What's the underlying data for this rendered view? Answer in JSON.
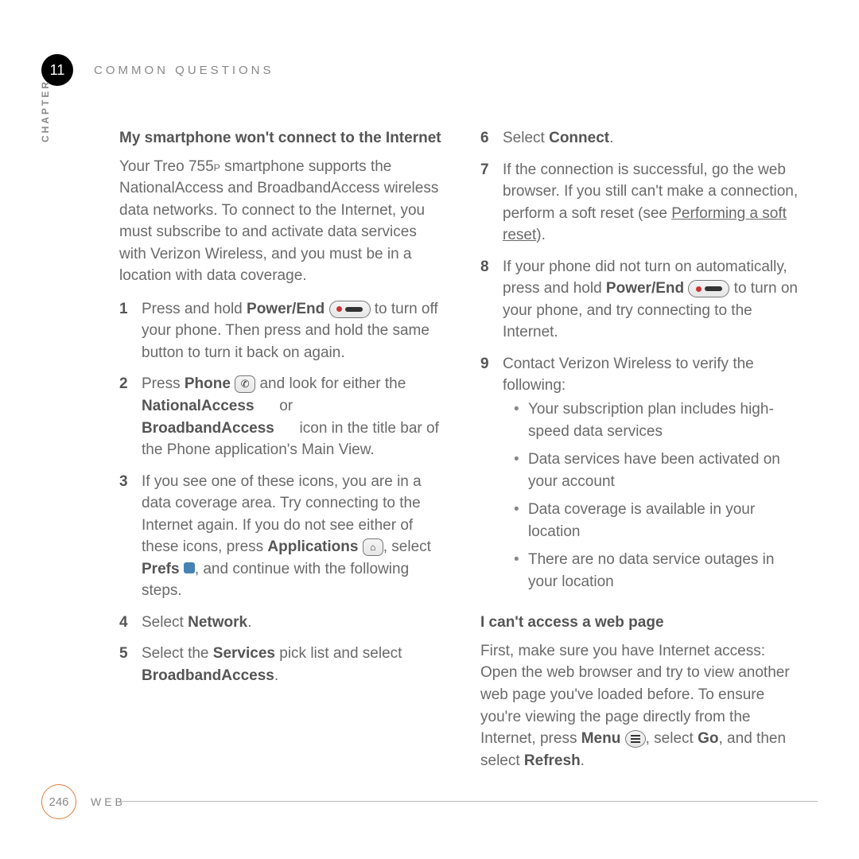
{
  "header": {
    "chapter_number": "11",
    "title": "COMMON QUESTIONS",
    "vertical_label": "CHAPTER"
  },
  "left": {
    "heading": "My smartphone won't connect to the Internet",
    "intro_a": "Your Treo 755",
    "intro_sub": "P",
    "intro_b": " smartphone supports the NationalAccess and BroadbandAccess wireless data networks. To connect to the Internet, you must subscribe to and activate data services with Verizon Wireless, and you must be in a location with data coverage.",
    "step1_a": "Press and hold ",
    "step1_bold1": "Power/End",
    "step1_b": " to turn off your phone. Then press and hold the same button to turn it back on again.",
    "step2_a": "Press ",
    "step2_bold1": "Phone",
    "step2_b": " and look for either the ",
    "step2_bold2": "NationalAccess",
    "step2_c": " or ",
    "step2_bold3": "BroadbandAccess",
    "step2_d": " icon in the title bar of the Phone application's Main View.",
    "step3_a": "If you see one of these icons, you are in a data coverage area. Try connecting to the Internet again. If you do not see either of these icons, press ",
    "step3_bold1": "Applications",
    "step3_b": ", select ",
    "step3_bold2": "Prefs",
    "step3_c": ", and continue with the following steps.",
    "step4_a": "Select ",
    "step4_bold1": "Network",
    "step4_b": ".",
    "step5_a": "Select the ",
    "step5_bold1": "Services",
    "step5_b": " pick list and select ",
    "step5_bold2": "BroadbandAccess",
    "step5_c": "."
  },
  "right": {
    "step6_a": "Select ",
    "step6_bold1": "Connect",
    "step6_b": ".",
    "step7_a": "If the connection is successful, go the web browser. If you still can't make a connection, perform a soft reset (see ",
    "step7_link": "Performing a soft reset",
    "step7_b": ").",
    "step8_a": "If your phone did not turn on automatically, press and hold ",
    "step8_bold1": "Power/End",
    "step8_b": " to turn on your phone, and try connecting to the Internet.",
    "step9_a": "Contact Verizon Wireless to verify the following:",
    "bullets": [
      "Your subscription plan includes high-speed data services",
      "Data services have been activated on your account",
      "Data coverage is available in your location",
      "There are no data service outages in your location"
    ],
    "heading2": "I can't access a web page",
    "para2_a": "First, make sure you have Internet access: Open the web browser and try to view another web page you've loaded before. To ensure you're viewing the page directly from the Internet, press ",
    "para2_bold1": "Menu",
    "para2_b": ", select ",
    "para2_bold2": "Go",
    "para2_c": ", and then select ",
    "para2_bold3": "Refresh",
    "para2_d": "."
  },
  "footer": {
    "page_number": "246",
    "section": "WEB"
  },
  "step_numbers": {
    "s1": "1",
    "s2": "2",
    "s3": "3",
    "s4": "4",
    "s5": "5",
    "s6": "6",
    "s7": "7",
    "s8": "8",
    "s9": "9"
  }
}
